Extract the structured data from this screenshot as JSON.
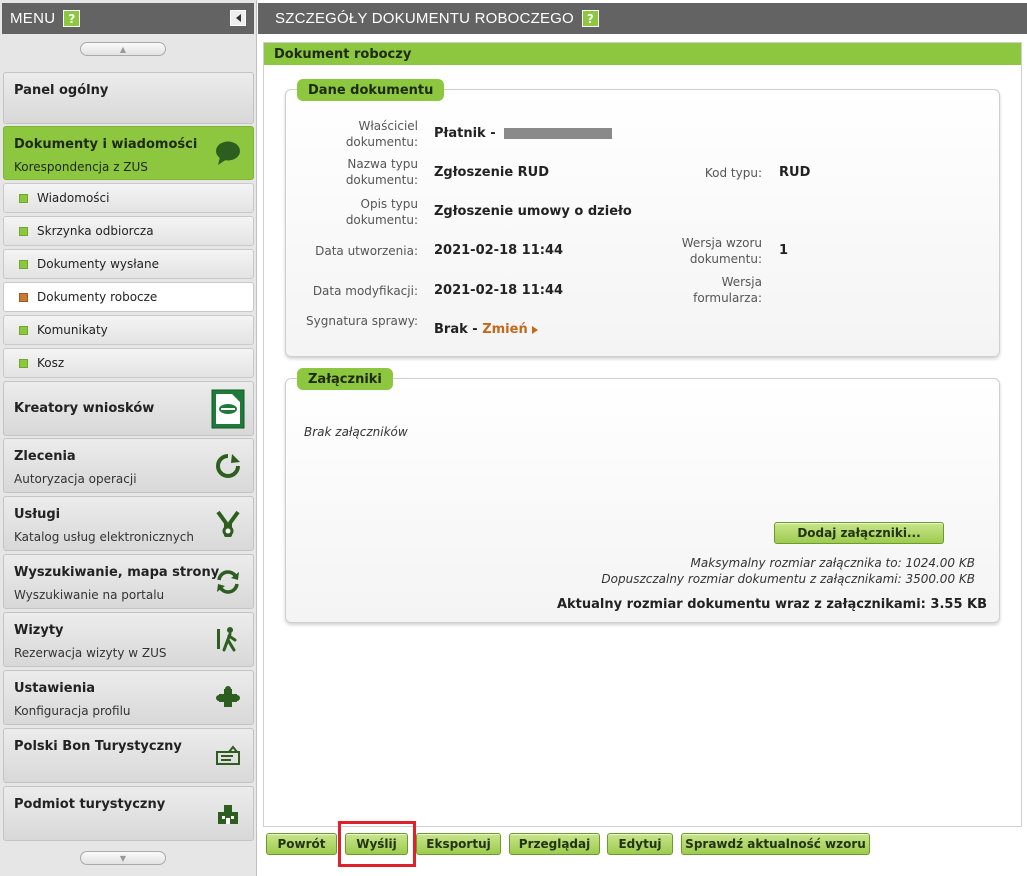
{
  "sidebar": {
    "title": "MENU",
    "help": "?",
    "items": [
      {
        "label": "Panel ogólny",
        "sub": ""
      },
      {
        "label": "Dokumenty i wiadomości",
        "sub": "Korespondencja z ZUS"
      },
      {
        "label": "Kreatory wniosków",
        "sub": ""
      },
      {
        "label": "Zlecenia",
        "sub": "Autoryzacja operacji"
      },
      {
        "label": "Usługi",
        "sub": "Katalog usług elektronicznych"
      },
      {
        "label": "Wyszukiwanie, mapa strony",
        "sub": "Wyszukiwanie na portalu"
      },
      {
        "label": "Wizyty",
        "sub": "Rezerwacja wizyty w ZUS"
      },
      {
        "label": "Ustawienia",
        "sub": "Konfiguracja profilu"
      },
      {
        "label": "Polski Bon Turystyczny",
        "sub": ""
      },
      {
        "label": "Podmiot turystyczny",
        "sub": ""
      }
    ],
    "subitems": [
      "Wiadomości",
      "Skrzynka odbiorcza",
      "Dokumenty wysłane",
      "Dokumenty robocze",
      "Komunikaty",
      "Kosz"
    ]
  },
  "header": {
    "title": "SZCZEGÓŁY DOKUMENTU ROBOCZEGO",
    "help": "?"
  },
  "panel": {
    "title": "Dokument roboczy"
  },
  "document": {
    "group_title": "Dane dokumentu",
    "owner_label": "Właściciel dokumentu:",
    "owner_value": "Płatnik -",
    "type_name_label": "Nazwa typu dokumentu:",
    "type_name_value": "Zgłoszenie RUD",
    "type_code_label": "Kod typu:",
    "type_code_value": "RUD",
    "type_desc_label": "Opis typu dokumentu:",
    "type_desc_value": "Zgłoszenie umowy o dzieło",
    "created_label": "Data utworzenia:",
    "created_value": "2021-02-18 11:44",
    "template_version_label": "Wersja wzoru dokumentu:",
    "template_version_value": "1",
    "modified_label": "Data modyfikacji:",
    "modified_value": "2021-02-18 11:44",
    "form_version_label": "Wersja formularza:",
    "form_version_value": "",
    "signature_label": "Sygnatura sprawy:",
    "signature_value": "Brak -",
    "change_link": "Zmień"
  },
  "attachments": {
    "group_title": "Załączniki",
    "empty_text": "Brak załączników",
    "add_button": "Dodaj załączniki...",
    "max_attachment": "Maksymalny rozmiar załącznika to: 1024.00 KB",
    "max_document": "Dopuszczalny rozmiar dokumentu z załącznikami: 3500.00 KB",
    "current_size": "Aktualny rozmiar dokumentu wraz z załącznikami: 3.55 KB"
  },
  "actions": {
    "back": "Powrót",
    "send": "Wyślij",
    "export": "Eksportuj",
    "browse": "Przeglądaj",
    "edit": "Edytuj",
    "check": "Sprawdź aktualność wzoru"
  },
  "colors": {
    "accent": "#8dc63f",
    "header": "#636363",
    "highlight": "#e0202a",
    "link": "#c26a1a"
  }
}
